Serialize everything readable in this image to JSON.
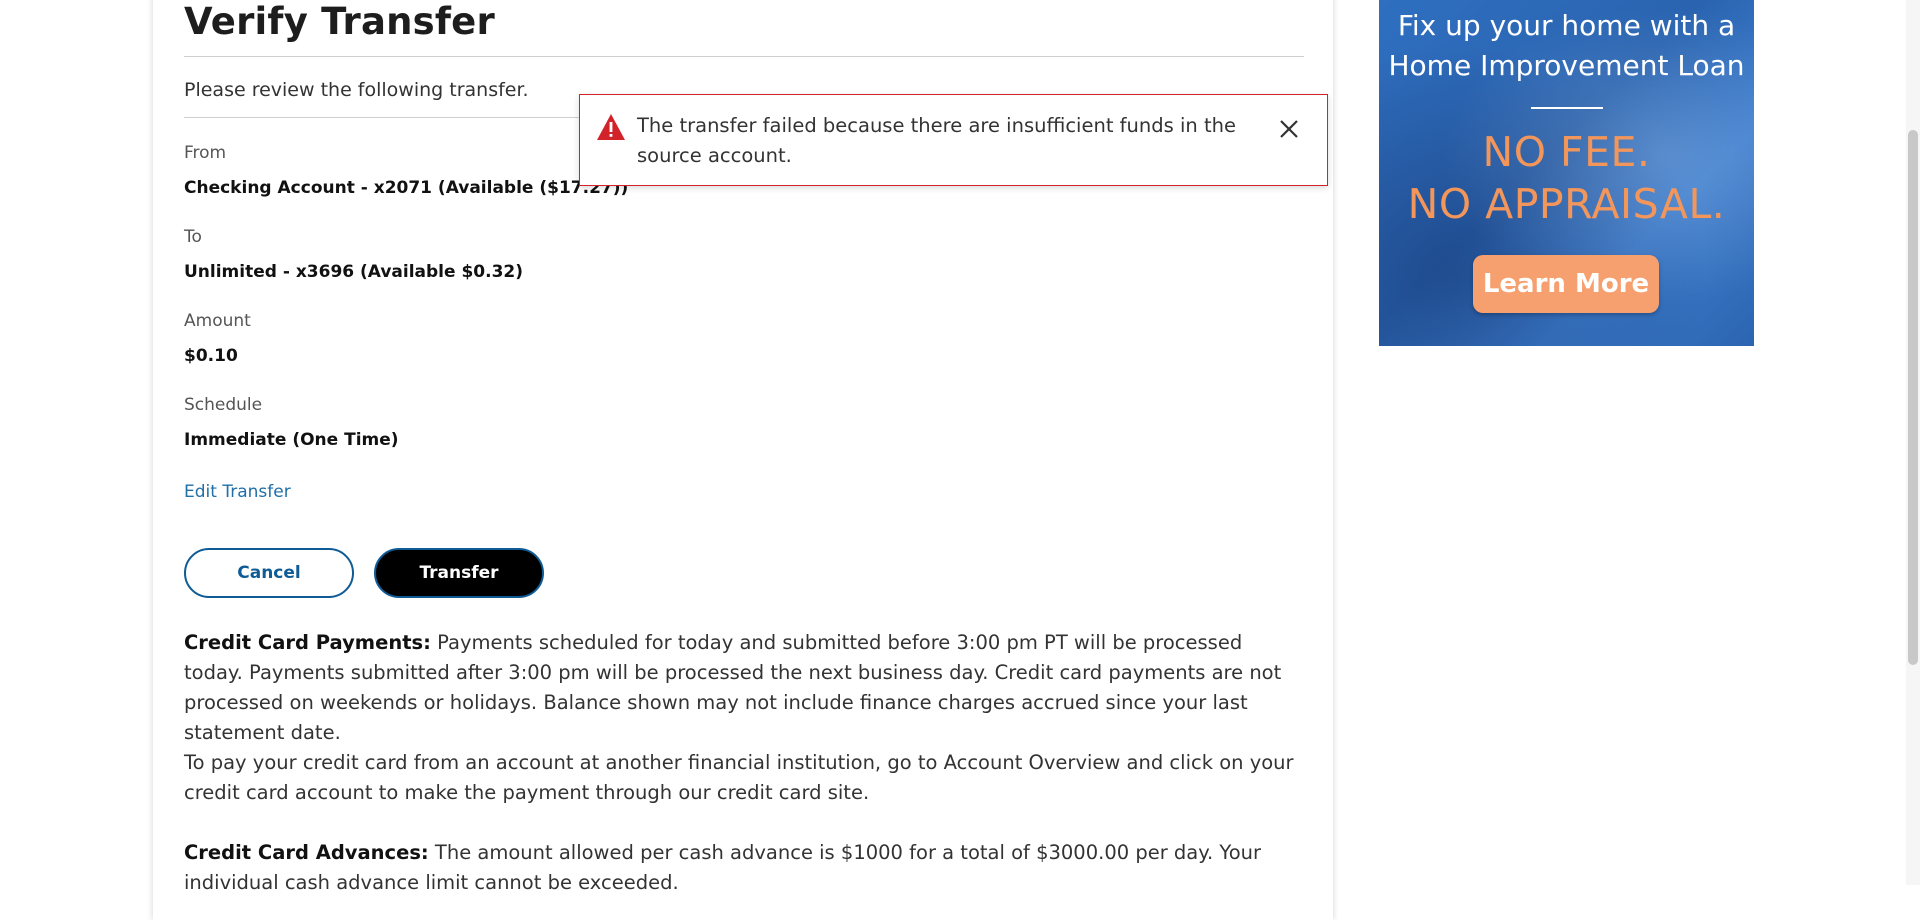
{
  "page": {
    "title": "Verify Transfer",
    "intro": "Please review the following transfer."
  },
  "transfer": {
    "from_label": "From",
    "from_value": "Checking Account - x2071 (Available  ($17.27))",
    "to_label": "To",
    "to_value": "Unlimited - x3696 (Available  $0.32)",
    "amount_label": "Amount",
    "amount_value": "$0.10",
    "schedule_label": "Schedule",
    "schedule_value": "Immediate (One Time)",
    "edit_link": "Edit Transfer"
  },
  "actions": {
    "cancel_label": "Cancel",
    "transfer_label": "Transfer"
  },
  "info": {
    "cc_payments_heading": "Credit Card Payments:",
    "cc_payments_text": " Payments scheduled for today and submitted before 3:00 pm PT will be processed today. Payments submitted after 3:00 pm will be processed the next business day. Credit card payments are not processed on weekends or holidays. Balance shown may not include finance charges accrued since your last statement date.",
    "cc_other_institution_text": "To pay your credit card from an account at another financial institution, go to Account Overview and click on your credit card account to make the payment through our credit card site.",
    "cc_advances_heading": "Credit Card Advances:",
    "cc_advances_text": " The amount allowed per cash advance is $1000 for a total of $3000.00 per day. Your individual cash advance limit cannot be exceeded."
  },
  "alert": {
    "message": "The transfer failed because there are insufficient funds in the source account.",
    "icon": "warning-icon",
    "close_icon": "close-icon",
    "color": "#d2232a"
  },
  "ad": {
    "headline_line1": "Fix up your home with a",
    "headline_line2": "Home Improvement Loan",
    "offer_line1": "NO FEE.",
    "offer_line2": "NO APPRAISAL.",
    "button_label": "Learn More",
    "offer_color": "#f3965b"
  },
  "colors": {
    "link": "#1f6fa8",
    "button_border": "#0e5b96"
  }
}
